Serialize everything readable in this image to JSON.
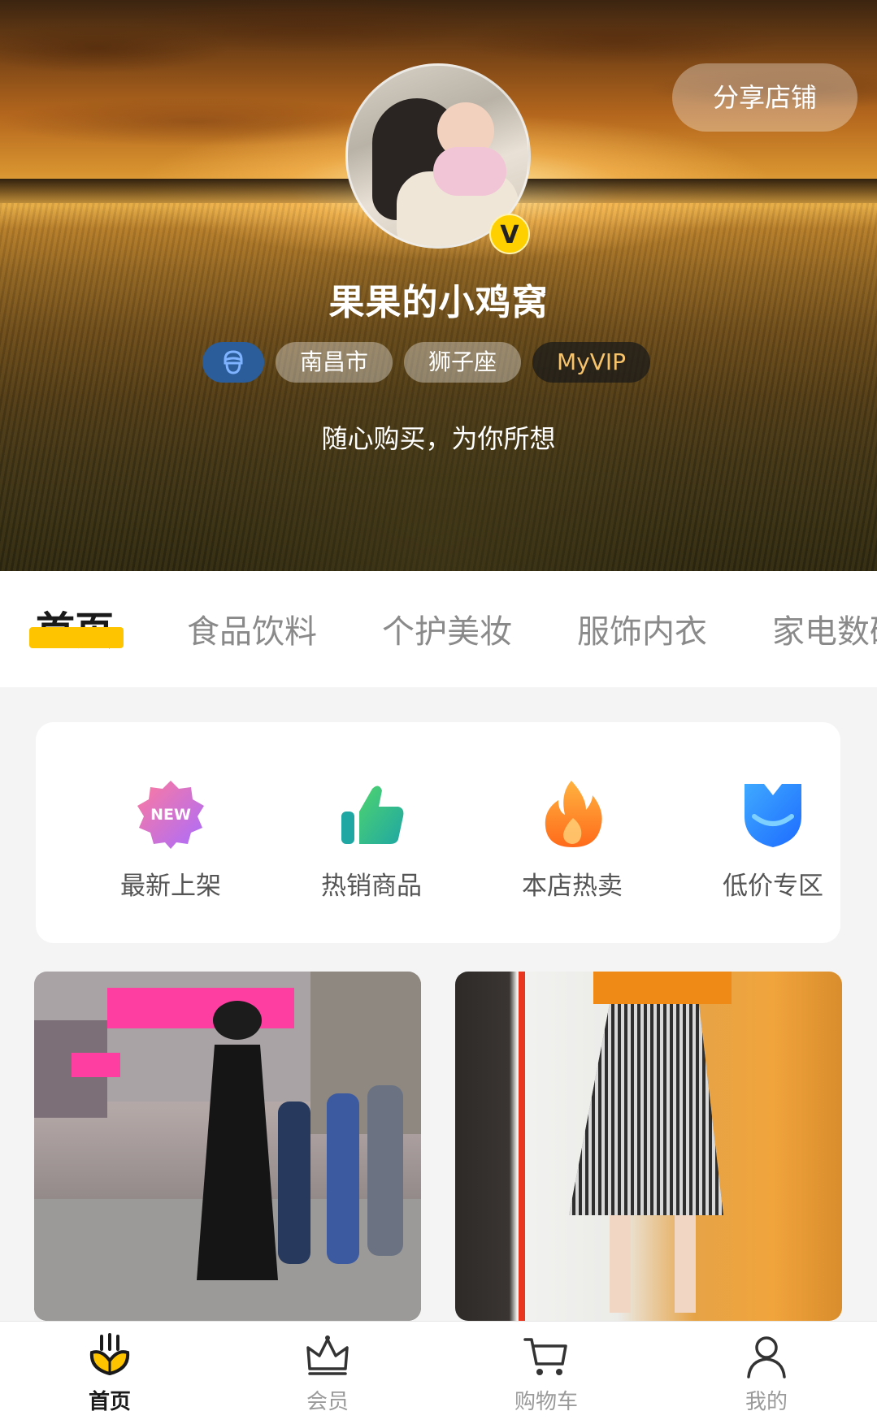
{
  "header": {
    "share_button": "分享店铺",
    "shop_name": "果果的小鸡窝",
    "badge": "V",
    "tags": [
      "南昌市",
      "狮子座",
      "MyVIP"
    ],
    "motto": "随心购买，为你所想"
  },
  "tabs": [
    {
      "label": "首页",
      "active": true
    },
    {
      "label": "食品饮料",
      "active": false
    },
    {
      "label": "个护美妆",
      "active": false
    },
    {
      "label": "服饰内衣",
      "active": false
    },
    {
      "label": "家电数码",
      "active": false
    }
  ],
  "quick_links": [
    {
      "label": "最新上架",
      "icon": "new-badge-icon",
      "icon_text": "NEW"
    },
    {
      "label": "热销商品",
      "icon": "thumbs-up-icon"
    },
    {
      "label": "本店热卖",
      "icon": "flame-icon"
    },
    {
      "label": "低价专区",
      "icon": "low-price-shield-icon"
    }
  ],
  "products": [
    {
      "image": "woman-street-photo"
    },
    {
      "image": "striped-skirt-photo"
    }
  ],
  "bottom_nav": [
    {
      "label": "首页",
      "icon": "home-crown-icon",
      "active": true
    },
    {
      "label": "会员",
      "icon": "member-crown-icon",
      "active": false
    },
    {
      "label": "购物车",
      "icon": "cart-icon",
      "active": false
    },
    {
      "label": "我的",
      "icon": "user-icon",
      "active": false
    }
  ],
  "colors": {
    "accent": "#ffc400",
    "vip_text": "#f7c46b",
    "tab_inactive": "#8a8a8a"
  }
}
